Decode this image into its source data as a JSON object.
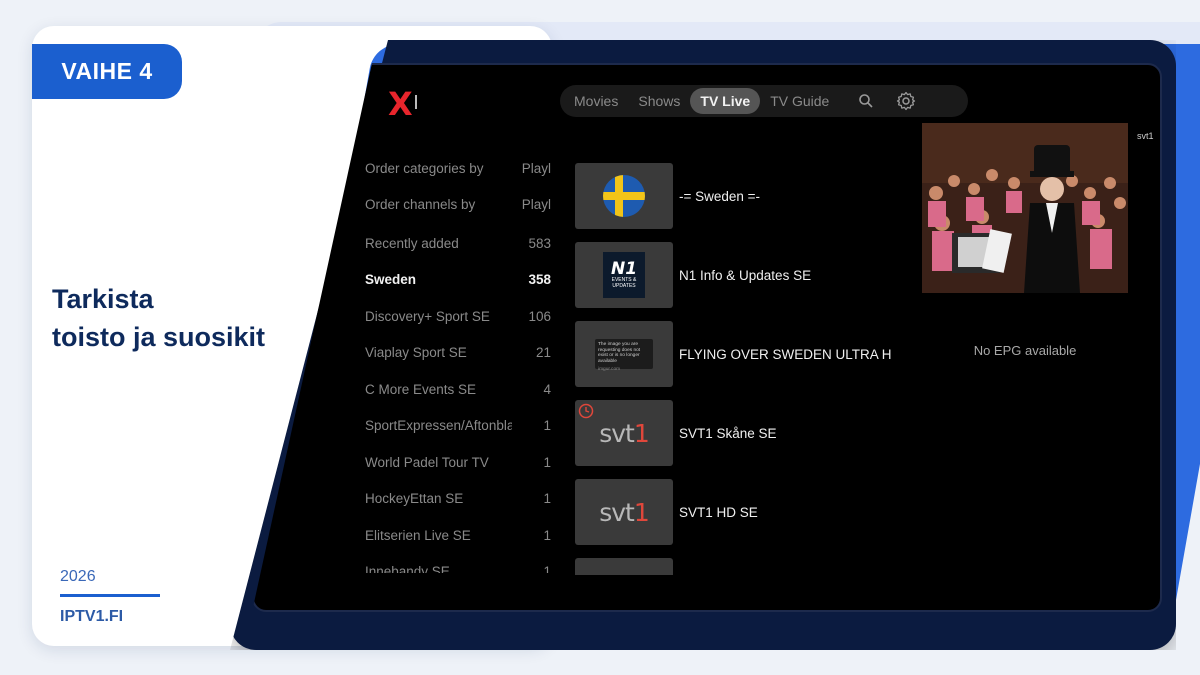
{
  "badge": {
    "label": "VAIHE 4"
  },
  "headline": {
    "line1": "Tarkista",
    "line2": "toisto ja suosikit"
  },
  "footer": {
    "year": "2026",
    "site": "IPTV1.FI"
  },
  "app": {
    "nav": [
      {
        "label": "Movies",
        "active": false
      },
      {
        "label": "Shows",
        "active": false
      },
      {
        "label": "TV Live",
        "active": true
      },
      {
        "label": "TV Guide",
        "active": false
      }
    ],
    "nav_icons": [
      "search-icon",
      "gear-icon"
    ],
    "categories": [
      {
        "name": "Order categories by",
        "count": "Playl"
      },
      {
        "name": "Order channels by",
        "count": "Playl"
      },
      {
        "name": "Recently added",
        "count": "583"
      },
      {
        "name": "Sweden",
        "count": "358",
        "selected": true
      },
      {
        "name": "Discovery+ Sport SE",
        "count": "106"
      },
      {
        "name": "Viaplay Sport SE",
        "count": "21"
      },
      {
        "name": "C More Events SE",
        "count": "4"
      },
      {
        "name": "SportExpressen/Aftonbladet",
        "count": "1"
      },
      {
        "name": "World Padel Tour TV",
        "count": "1"
      },
      {
        "name": "HockeyEttan SE",
        "count": "1"
      },
      {
        "name": "Elitserien Live SE",
        "count": "1"
      },
      {
        "name": "Innebandy SE",
        "count": "1"
      }
    ],
    "channels": [
      {
        "name": "-= Sweden =-",
        "logo": "sweden-flag"
      },
      {
        "name": "N1 Info & Updates SE",
        "logo": "n1-logo",
        "logo_text": "N1",
        "logo_sub": "EVENTS & UPDATES"
      },
      {
        "name": "FLYING OVER SWEDEN ULTRA H",
        "logo": "error-thumbnail",
        "logo_text": "The image you are requesting does not exist or is no longer available",
        "logo_sub": "imgur.com"
      },
      {
        "name": "SVT1 Skåne SE",
        "logo": "svt1-logo",
        "logo_text": "svt1"
      },
      {
        "name": "SVT1 HD SE",
        "logo": "svt1-logo",
        "logo_text": "svt1"
      }
    ],
    "preview": {
      "channel_label": "svt1",
      "epg": "No EPG available"
    },
    "colors": {
      "accent": "#1b5fcf",
      "logo_red": "#e8252c",
      "screen_bg": "#000000"
    }
  }
}
